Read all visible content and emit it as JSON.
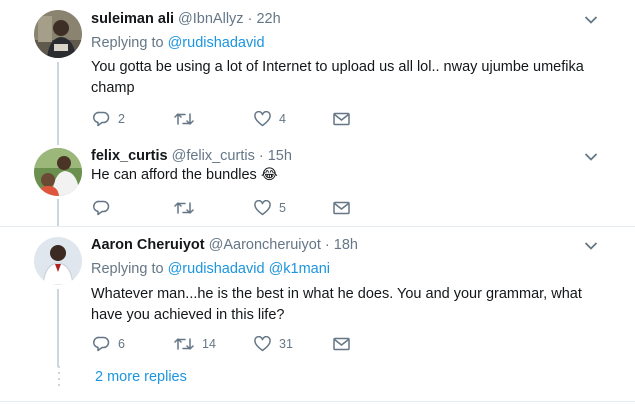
{
  "tweets": [
    {
      "name": "suleiman ali",
      "handle": "@IbnAllyz",
      "dot": "·",
      "time": "22h",
      "replying_label": "Replying to",
      "replying_to": [
        "@rudishadavid"
      ],
      "text_lines": [
        "You gotta be using a lot of Internet to upload us all lol.. nway ujumbe umefika",
        "champ"
      ],
      "replies": "2",
      "retweets": "",
      "likes": "4"
    },
    {
      "name": "felix_curtis",
      "handle": "@felix_curtis",
      "dot": "·",
      "time": "15h",
      "text_lines": [
        "He can afford the bundles 😂"
      ],
      "replies": "",
      "retweets": "",
      "likes": "5"
    },
    {
      "name": "Aaron Cheruiyot",
      "handle": "@Aaroncheruiyot",
      "dot": "·",
      "time": "18h",
      "replying_label": "Replying to",
      "replying_to": [
        "@rudishadavid",
        "@k1mani"
      ],
      "text_lines": [
        "Whatever man...he is the best in what he does. You and your grammar, what",
        "have you achieved in this life?"
      ],
      "replies": "6",
      "retweets": "14",
      "likes": "31"
    }
  ],
  "more_replies": "2 more replies",
  "icons": {
    "reply": "reply-icon",
    "retweet": "retweet-icon",
    "like": "heart-icon",
    "dm": "envelope-icon",
    "menu": "chevron-down-icon"
  },
  "colors": {
    "action_gray": "#657786",
    "link_blue": "#1b95e0",
    "divider": "#e6ecf0"
  }
}
